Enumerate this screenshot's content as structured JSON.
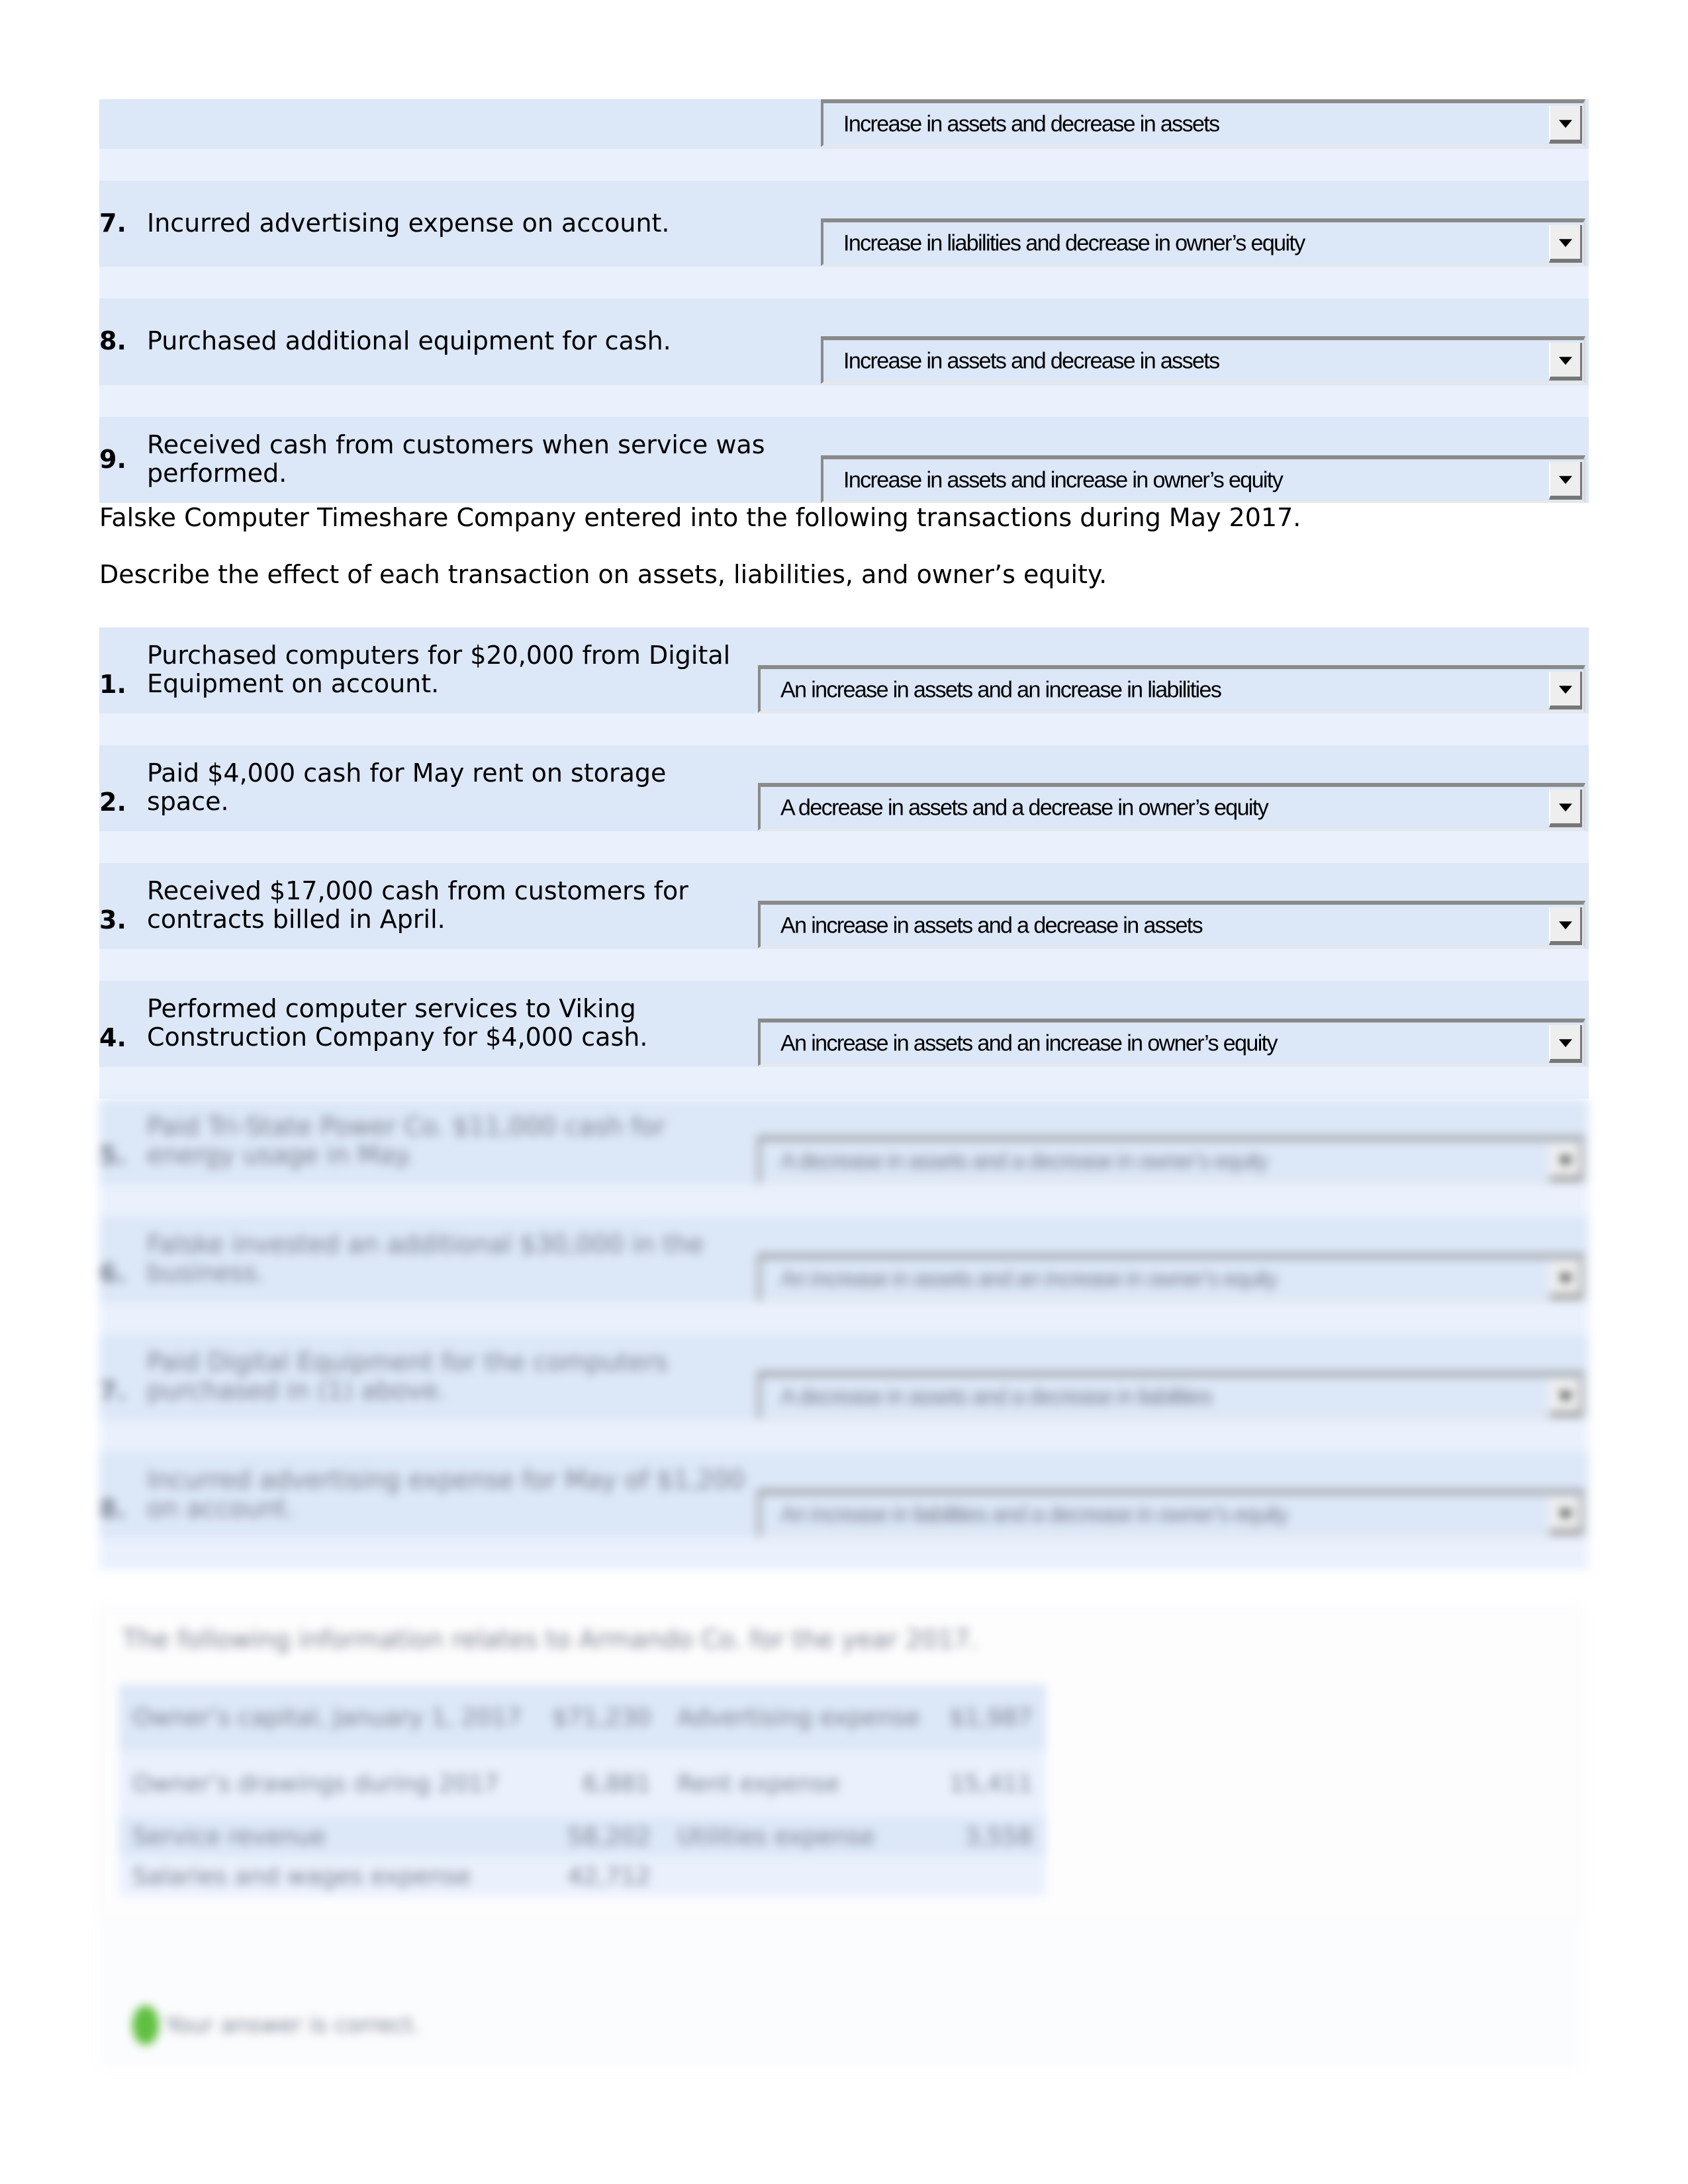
{
  "section1": {
    "rows": [
      {
        "number": "",
        "description": "",
        "selected": "Increase in assets and decrease in assets"
      },
      {
        "number": "7.",
        "description": "Incurred advertising expense on account.",
        "selected": "Increase in liabilities and decrease in owner’s equity"
      },
      {
        "number": "8.",
        "description": "Purchased additional equipment for cash.",
        "selected": "Increase in assets and decrease in assets"
      },
      {
        "number": "9.",
        "description_line1": "Received cash from customers when service was",
        "description_line2": "performed.",
        "selected": "Increase in assets and increase in owner’s equity"
      }
    ]
  },
  "section2": {
    "intro": "Falske Computer Timeshare Company entered into the following transactions during May 2017.",
    "instruction": "Describe the effect of each transaction on assets, liabilities, and owner’s equity.",
    "rows": [
      {
        "number": "1.",
        "line1": "Purchased computers for $20,000 from Digital",
        "line2": "Equipment on account.",
        "selected": "An increase in assets and an increase in liabilities"
      },
      {
        "number": "2.",
        "line1": "Paid $4,000 cash for May rent on storage",
        "line2": "space.",
        "selected": "A decrease in assets and a decrease in owner’s equity"
      },
      {
        "number": "3.",
        "line1": "Received $17,000 cash from customers for",
        "line2": "contracts billed in April.",
        "selected": "An increase in assets and a decrease in assets"
      },
      {
        "number": "4.",
        "line1": "Performed computer services to Viking",
        "line2": "Construction Company for $4,000 cash.",
        "selected": "An increase in assets and an increase in owner’s equity"
      }
    ],
    "blurred_rows": [
      {
        "number": "5.",
        "line1": "Paid Tri-State Power Co. $11,000 cash for",
        "line2": "energy usage in May.",
        "selected": "A decrease in assets and a decrease in owner’s equity"
      },
      {
        "number": "6.",
        "line1": "Falske invested an additional $30,000 in the",
        "line2": "business.",
        "selected": "An increase in assets and an increase in owner’s equity"
      },
      {
        "number": "7.",
        "line1": "Paid Digital Equipment for the computers",
        "line2": "purchased in (1) above.",
        "selected": "A decrease in assets and a decrease in liabilities"
      },
      {
        "number": "8.",
        "line1": "Incurred advertising expense for May of $1,200",
        "line2": "on account.",
        "selected": "An increase in liabilities and a decrease in owner’s equity"
      }
    ]
  },
  "section3": {
    "intro": "The following information relates to Armando Co. for the year 2017.",
    "table": [
      [
        "Owner’s capital, January 1, 2017",
        "$71,230",
        "Advertising expense",
        "$1,987"
      ],
      [
        "Owner’s drawings during 2017",
        "6,881",
        "Rent expense",
        "15,411"
      ],
      [
        "Service revenue",
        "58,202",
        "Utilities expense",
        "3,558"
      ],
      [
        "Salaries and wages expense",
        "42,712",
        "",
        ""
      ]
    ],
    "status": "Your answer is correct."
  }
}
